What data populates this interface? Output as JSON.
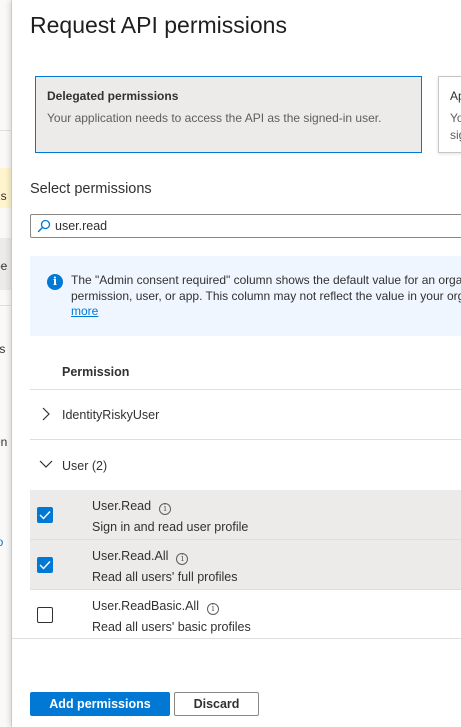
{
  "background": {
    "fragments": [
      "ns",
      "pe",
      "lis",
      "en",
      "io"
    ]
  },
  "panel": {
    "title": "Request API permissions",
    "cards": [
      {
        "title": "Delegated permissions",
        "description": "Your application needs to access the API as the signed-in user."
      },
      {
        "title": "Ap",
        "description_line1": "Yo",
        "description_line2": "sig"
      }
    ],
    "select_label": "Select permissions",
    "search": {
      "value": "user.read"
    },
    "info": {
      "line1": "The \"Admin consent required\" column shows the default value for an orga",
      "line2": "permission, user, or app. This column may not reflect the value in your org",
      "more": "more"
    },
    "table": {
      "header": "Permission",
      "groups": [
        {
          "label": "IdentityRiskyUser",
          "expanded": false
        },
        {
          "label": "User (2)",
          "expanded": true
        }
      ],
      "rows": [
        {
          "name": "User.Read",
          "description": "Sign in and read user profile",
          "checked": true
        },
        {
          "name": "User.Read.All",
          "description": "Read all users' full profiles",
          "checked": true
        },
        {
          "name": "User.ReadBasic.All",
          "description": "Read all users' basic profiles",
          "checked": false
        }
      ]
    },
    "buttons": {
      "add": "Add permissions",
      "discard": "Discard"
    }
  },
  "colors": {
    "accent": "#0078d4",
    "selected_row": "#edebe9",
    "info_bg": "#f0f6ff"
  }
}
